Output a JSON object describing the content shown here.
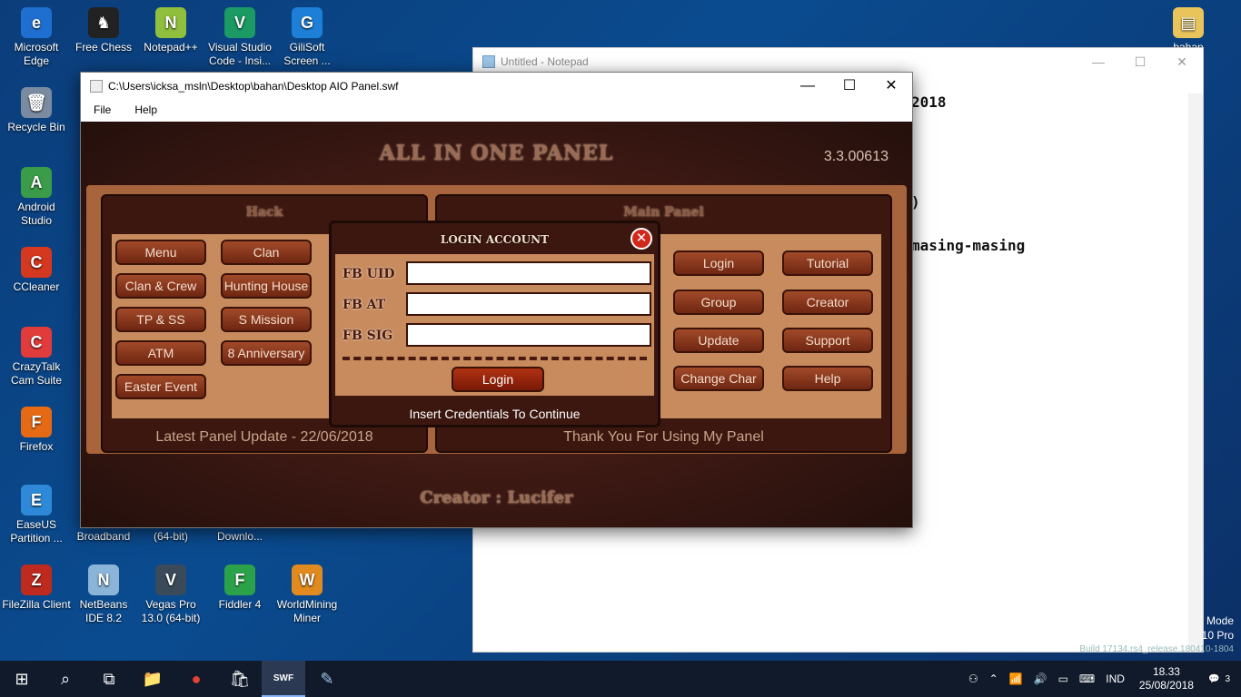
{
  "desktop_icons": [
    {
      "label": "Microsoft Edge",
      "glyph": "e",
      "color": "#1f6fd1"
    },
    {
      "label": "Free Chess",
      "glyph": "♞",
      "color": "#222222"
    },
    {
      "label": "Notepad++",
      "glyph": "N",
      "color": "#8fbf3c"
    },
    {
      "label": "Visual Studio Code - Insi...",
      "glyph": "V",
      "color": "#1b9a63"
    },
    {
      "label": "GiliSoft Screen ...",
      "glyph": "G",
      "color": "#1e7fd8"
    },
    {
      "label": "Recycle Bin",
      "glyph": "🗑",
      "color": "#7a8aa0"
    },
    {
      "label": "Android Studio",
      "glyph": "A",
      "color": "#3a9b48"
    },
    {
      "label": "CCleaner",
      "glyph": "C",
      "color": "#d4381f"
    },
    {
      "label": "CrazyTalk Cam Suite",
      "glyph": "C",
      "color": "#e23b3b"
    },
    {
      "label": "Firefox",
      "glyph": "F",
      "color": "#e66a14"
    },
    {
      "label": "EaseUS Partition ...",
      "glyph": "E",
      "color": "#2e8ad8"
    },
    {
      "label": "Broadband",
      "glyph": "",
      "color": "transparent"
    },
    {
      "label": "(64-bit)",
      "glyph": "",
      "color": "transparent"
    },
    {
      "label": "Downlo...",
      "glyph": "",
      "color": "transparent"
    },
    {
      "label": "FileZilla Client",
      "glyph": "Z",
      "color": "#bf2a1e"
    },
    {
      "label": "NetBeans IDE 8.2",
      "glyph": "N",
      "color": "#8ab4d8"
    },
    {
      "label": "Vegas Pro 13.0 (64-bit)",
      "glyph": "V",
      "color": "#3a4a5a"
    },
    {
      "label": "Fiddler 4",
      "glyph": "F",
      "color": "#2ba24a"
    },
    {
      "label": "WorldMining Miner",
      "glyph": "W",
      "color": "#e08a1f"
    },
    {
      "label": "bahan",
      "glyph": "▤",
      "color": "#e8c45a"
    }
  ],
  "notepad": {
    "title": "Untitled - Notepad",
    "lines": [
      "2018",
      "",
      "",
      "",
      ")",
      "",
      "",
      "masing-masing"
    ]
  },
  "swf_window": {
    "title": "C:\\Users\\icksa_msln\\Desktop\\bahan\\Desktop AIO Panel.swf",
    "menu": [
      "File",
      "Help"
    ],
    "controls": {
      "minimize": "—",
      "maximize": "☐",
      "close": "✕"
    }
  },
  "panel": {
    "title": "ALL IN ONE PANEL",
    "version": "3.3.00613",
    "left_box": {
      "title": "Hack",
      "buttons": [
        "Menu",
        "Clan",
        "Clan & Crew",
        "Hunting House",
        "TP & SS",
        "S Mission",
        "ATM",
        "8 Anniversary",
        "Easter Event"
      ],
      "footer": "Latest Panel Update - 22/06/2018"
    },
    "right_box": {
      "title": "Main Panel",
      "buttons": [
        "Login",
        "Tutorial",
        "Group",
        "Creator",
        "Update",
        "Support",
        "Change Char",
        "Help"
      ],
      "footer": "Thank You For Using My Panel"
    },
    "creator": "Creator : Lucifer"
  },
  "login_modal": {
    "title": "LOGIN ACCOUNT",
    "close": "✕",
    "fields": [
      {
        "label": "FB UID",
        "value": ""
      },
      {
        "label": "FB AT",
        "value": ""
      },
      {
        "label": "FB SIG",
        "value": ""
      }
    ],
    "login_label": "Login",
    "status": "Insert Credentials To Continue"
  },
  "taskbar": {
    "start": "⊞",
    "search": "⌕",
    "task_view": "⧉",
    "apps": [
      "📁",
      "●",
      "🛍",
      "SWF",
      "✎"
    ],
    "language": "IND",
    "time": "18.33",
    "date": "25/08/2018",
    "notifications": "3"
  },
  "watermark": {
    "line1": "Mode",
    "line2": "10 Pro",
    "line3": "Build 17134.rs4_release.180410-1804"
  }
}
